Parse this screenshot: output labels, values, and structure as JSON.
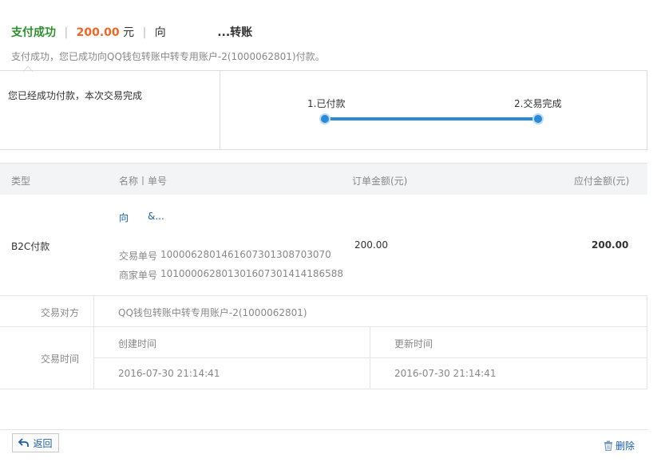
{
  "header": {
    "status": "支付成功",
    "separator": "|",
    "amount": "200.00",
    "unit": "元",
    "to_label": "向",
    "recipient": "...转账"
  },
  "subtitle": "支付成功，您已成功向QQ钱包转账中转专用账户-2(1000062801)付款。",
  "status_box": {
    "message": "您已经成功付款，本次交易完成",
    "steps": [
      "1.已付款",
      "2.交易完成"
    ],
    "accent_color": "#2b8ad6"
  },
  "table": {
    "headers": {
      "type": "类型",
      "name_order": "名称丨单号",
      "order_amount": "订单金额(元)",
      "payable_amount": "应付金额(元)"
    },
    "row": {
      "type": "B2C付款",
      "name_prefix": "向",
      "name_suffix": "&...",
      "trade_no_label": "交易单号",
      "trade_no": "1000062801461607301308703070",
      "merchant_no_label": "商家单号",
      "merchant_no": "101000062801301607301414186588",
      "order_amount": "200.00",
      "payable_amount": "200.00"
    }
  },
  "details": {
    "party_label": "交易对方",
    "party_value": "QQ钱包转账中转专用账户-2(1000062801)",
    "time_label": "交易时间",
    "created_label": "创建时间",
    "created_value": "2016-07-30 21:14:41",
    "updated_label": "更新时间",
    "updated_value": "2016-07-30 21:14:41"
  },
  "footer": {
    "back_label": "返回",
    "delete_label": "删除"
  }
}
